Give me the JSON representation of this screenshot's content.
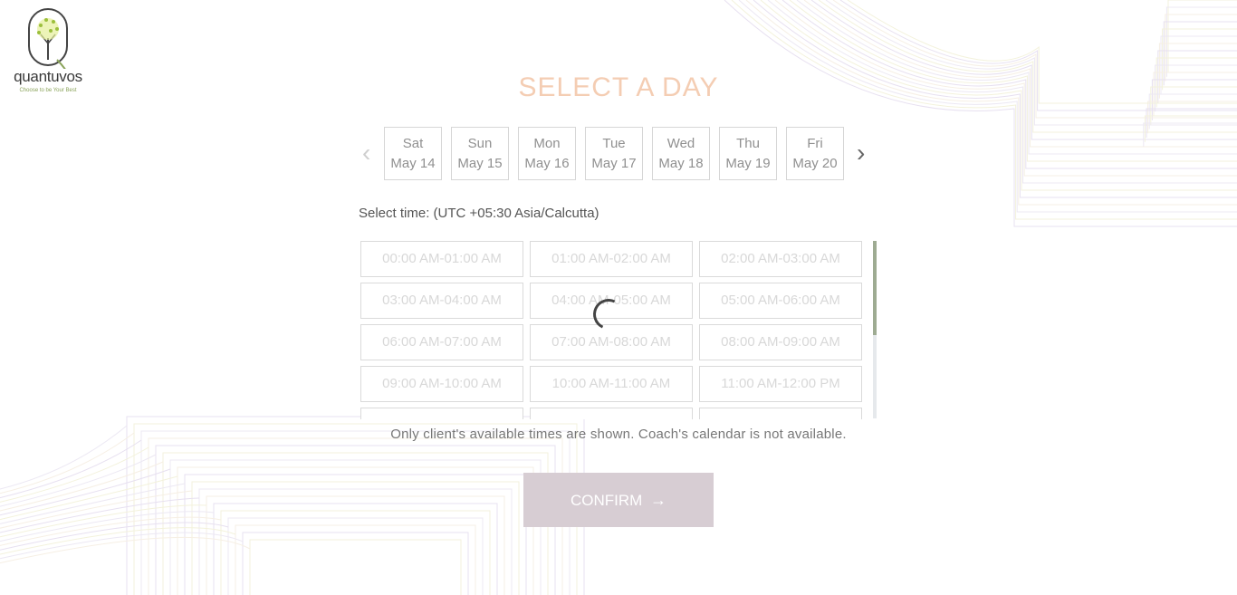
{
  "brand": {
    "name": "quantuvos",
    "tagline": "Choose to be Your Best"
  },
  "title": "SELECT A DAY",
  "days": [
    {
      "dow": "Sat",
      "date": "May 14"
    },
    {
      "dow": "Sun",
      "date": "May 15"
    },
    {
      "dow": "Mon",
      "date": "May 16"
    },
    {
      "dow": "Tue",
      "date": "May 17"
    },
    {
      "dow": "Wed",
      "date": "May 18"
    },
    {
      "dow": "Thu",
      "date": "May 19"
    },
    {
      "dow": "Fri",
      "date": "May 20"
    }
  ],
  "nav": {
    "prev": "‹",
    "next": "›"
  },
  "timezone_label": "Select time: (UTC +05:30 Asia/Calcutta)",
  "slots": [
    "00:00 AM-01:00 AM",
    "01:00 AM-02:00 AM",
    "02:00 AM-03:00 AM",
    "03:00 AM-04:00 AM",
    "04:00 AM-05:00 AM",
    "05:00 AM-06:00 AM",
    "06:00 AM-07:00 AM",
    "07:00 AM-08:00 AM",
    "08:00 AM-09:00 AM",
    "09:00 AM-10:00 AM",
    "10:00 AM-11:00 AM",
    "11:00 AM-12:00 PM",
    "",
    "",
    ""
  ],
  "availability_note": "Only client's available times are shown. Coach's calendar is not available.",
  "confirm": {
    "label": "CONFIRM",
    "arrow": "→"
  },
  "colors": {
    "title": "#f4cdb3",
    "confirm_bg": "#d7cdd3",
    "scroll_thumb": "#9eab92",
    "slot_text": "#d8d8d8",
    "brand_tagline": "#8aa35a"
  }
}
